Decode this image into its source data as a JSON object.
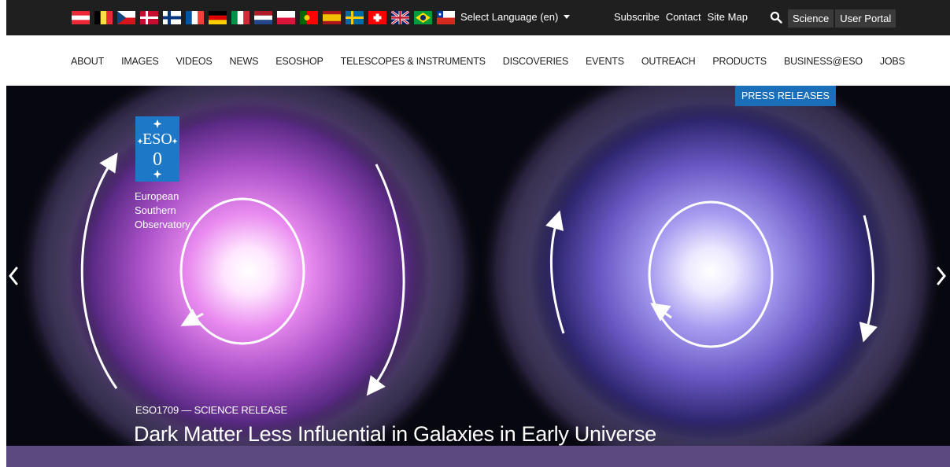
{
  "topbar": {
    "flags": [
      "at",
      "be",
      "cz",
      "dk",
      "fi",
      "fr",
      "de",
      "it",
      "nl",
      "pl",
      "pt",
      "es",
      "se",
      "ch",
      "uk",
      "br",
      "cl"
    ],
    "language": "Select Language (en)",
    "links": [
      "Subscribe",
      "Contact",
      "Site Map"
    ],
    "search_icon": "search-icon",
    "pills": [
      "Science",
      "User Portal"
    ],
    "colors": {
      "background": "#1f1f1f",
      "pill": "#3a3a3a"
    }
  },
  "nav": {
    "items": [
      "ABOUT",
      "IMAGES",
      "VIDEOS",
      "NEWS",
      "ESOSHOP",
      "TELESCOPES & INSTRUMENTS",
      "DISCOVERIES",
      "EVENTS",
      "OUTREACH",
      "PRODUCTS",
      "BUSINESS@ESO",
      "JOBS"
    ]
  },
  "hero": {
    "badge": "PRESS RELEASES",
    "logo": {
      "lettering": "ESO",
      "lines": [
        "European",
        "Southern",
        "Observatory"
      ]
    },
    "release_code": "ESO1709 — SCIENCE RELEASE",
    "title": "Dark Matter Less Influential in Galaxies in Early Universe",
    "prev_icon": "chevron-left-icon",
    "next_icon": "chevron-right-icon",
    "colors": {
      "badge": "#1a6fb8",
      "logo": "#1d78c8",
      "band": "#5a4a80"
    }
  }
}
